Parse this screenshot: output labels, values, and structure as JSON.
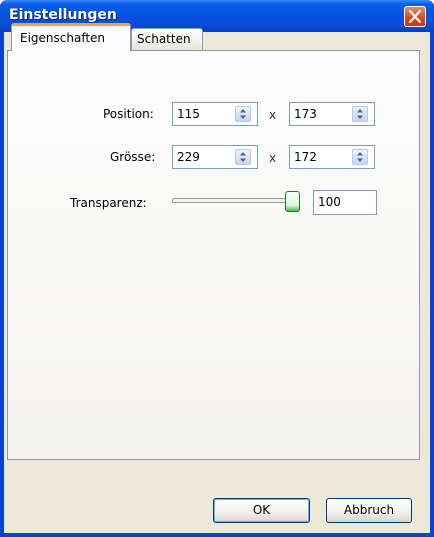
{
  "window": {
    "title": "Einstellungen"
  },
  "tabs": [
    {
      "label": "Eigenschaften",
      "active": true
    },
    {
      "label": "Schatten",
      "active": false
    }
  ],
  "form": {
    "position": {
      "label": "Position:",
      "x": "115",
      "y": "173"
    },
    "size": {
      "label": "Grösse:",
      "width": "229",
      "height": "172"
    },
    "separator": "x",
    "transparency": {
      "label": "Transparenz:",
      "value": "100",
      "slider_fraction": 1.0
    }
  },
  "buttons": {
    "ok": "OK",
    "cancel": "Abbruch"
  },
  "colors": {
    "titlebar": "#0552e0",
    "close": "#d64a1f",
    "tab_highlight": "#f5a623",
    "dialog_bg": "#ece9d8"
  },
  "icons": {
    "close": "close-icon",
    "spin": "spin-arrows-icon"
  }
}
